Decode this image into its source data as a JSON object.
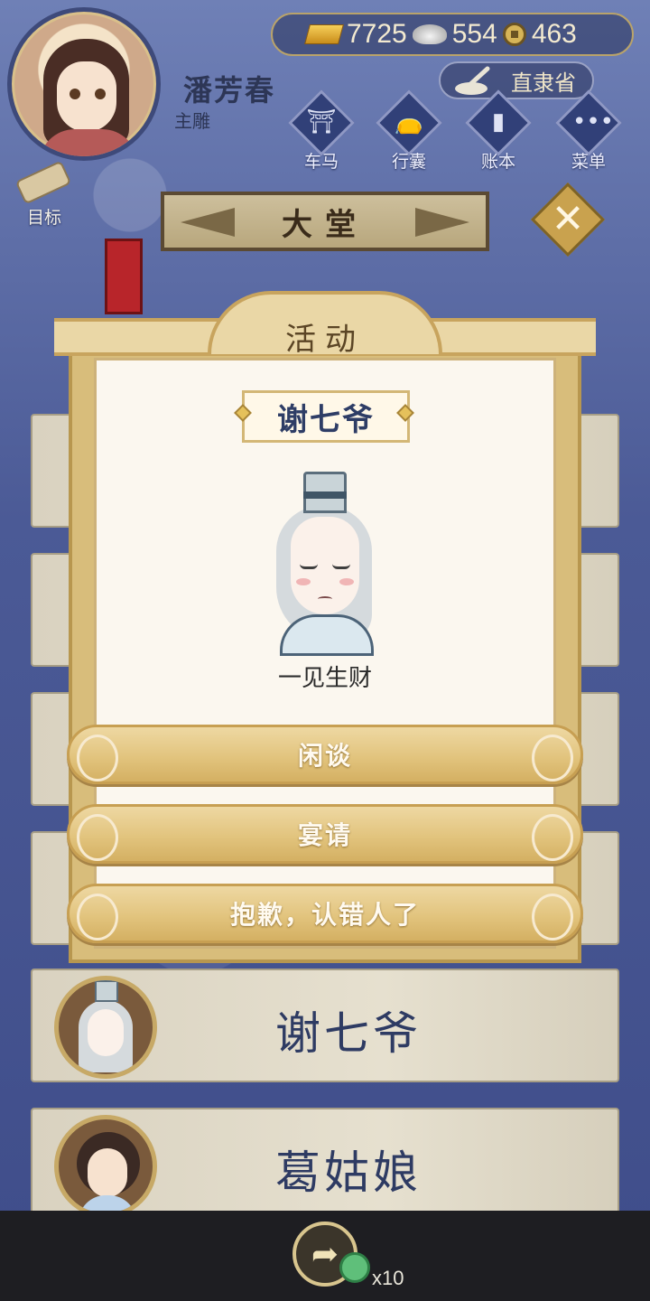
{
  "player": {
    "name": "潘芳春",
    "title": "主雕"
  },
  "currencies": {
    "gold": "7725",
    "silver": "554",
    "coins": "463"
  },
  "region": "直隶省",
  "menu": [
    {
      "label": "车马",
      "icon": "carriage-icon"
    },
    {
      "label": "行囊",
      "icon": "bag-icon"
    },
    {
      "label": "账本",
      "icon": "ledger-icon"
    },
    {
      "label": "菜单",
      "icon": "more-icon"
    }
  ],
  "goal_label": "目标",
  "hall_title": "大堂",
  "modal": {
    "title": "活动",
    "npc_name": "谢七爷",
    "npc_trait": "一见生财",
    "choices": [
      "闲谈",
      "宴请",
      "抱歉，认错人了"
    ]
  },
  "list": [
    {
      "name": "谢七爷"
    },
    {
      "name": "葛姑娘"
    }
  ],
  "bottom": {
    "jade_count": "x10"
  },
  "colors": {
    "accent_gold": "#d4b063",
    "navy": "#2e3d66",
    "background": "#4b5a96"
  }
}
